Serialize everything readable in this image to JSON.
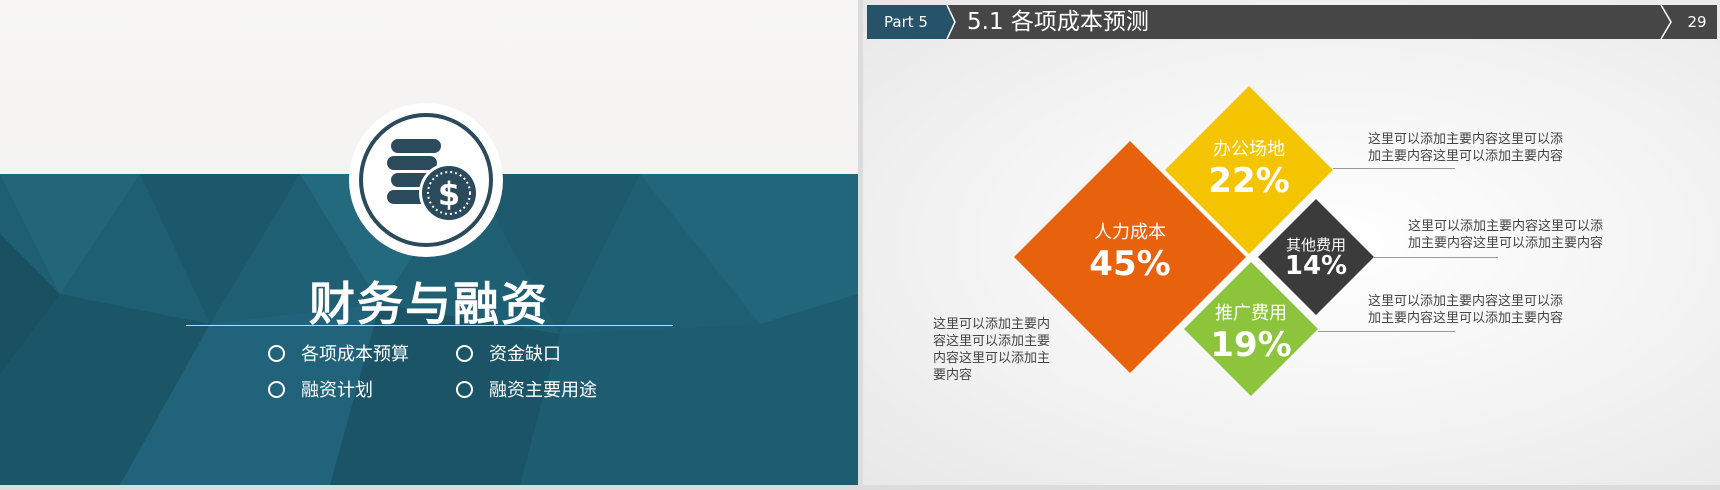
{
  "left_slide": {
    "title": "财务与融资",
    "menu": [
      {
        "label": "各项成本预算"
      },
      {
        "label": "资金缺口"
      },
      {
        "label": "融资计划"
      },
      {
        "label": "融资主要用途"
      }
    ],
    "emblem_icon": "coins-dollar-icon"
  },
  "right_slide": {
    "part_label": "Part 5",
    "title": "5.1 各项成本预测",
    "page_number": "29",
    "items": [
      {
        "label": "人力成本",
        "value": "45%",
        "color": "#e8610c"
      },
      {
        "label": "办公场地",
        "value": "22%",
        "color": "#f5c400"
      },
      {
        "label": "其他费用",
        "value": "14%",
        "color": "#3b3b3b"
      },
      {
        "label": "推广费用",
        "value": "19%",
        "color": "#8cc43c"
      }
    ],
    "descriptions": [
      {
        "lines": [
          "这里可以添加主要内容这里可以添",
          "加主要内容这里可以添加主要内容"
        ]
      },
      {
        "lines": [
          "这里可以添加主要内容这里可以添",
          "加主要内容这里可以添加主要内容"
        ]
      },
      {
        "lines": [
          "这里可以添加主要内容这里可以添",
          "加主要内容这里可以添加主要内容"
        ]
      },
      {
        "lines": [
          "这里可以添加主要内",
          "容这里可以添加主要",
          "内容这里可以添加主",
          "要内容"
        ]
      }
    ]
  },
  "colors": {
    "teal_band": "#1f5f74",
    "header_bar": "#464646",
    "part_badge": "#26526a"
  }
}
